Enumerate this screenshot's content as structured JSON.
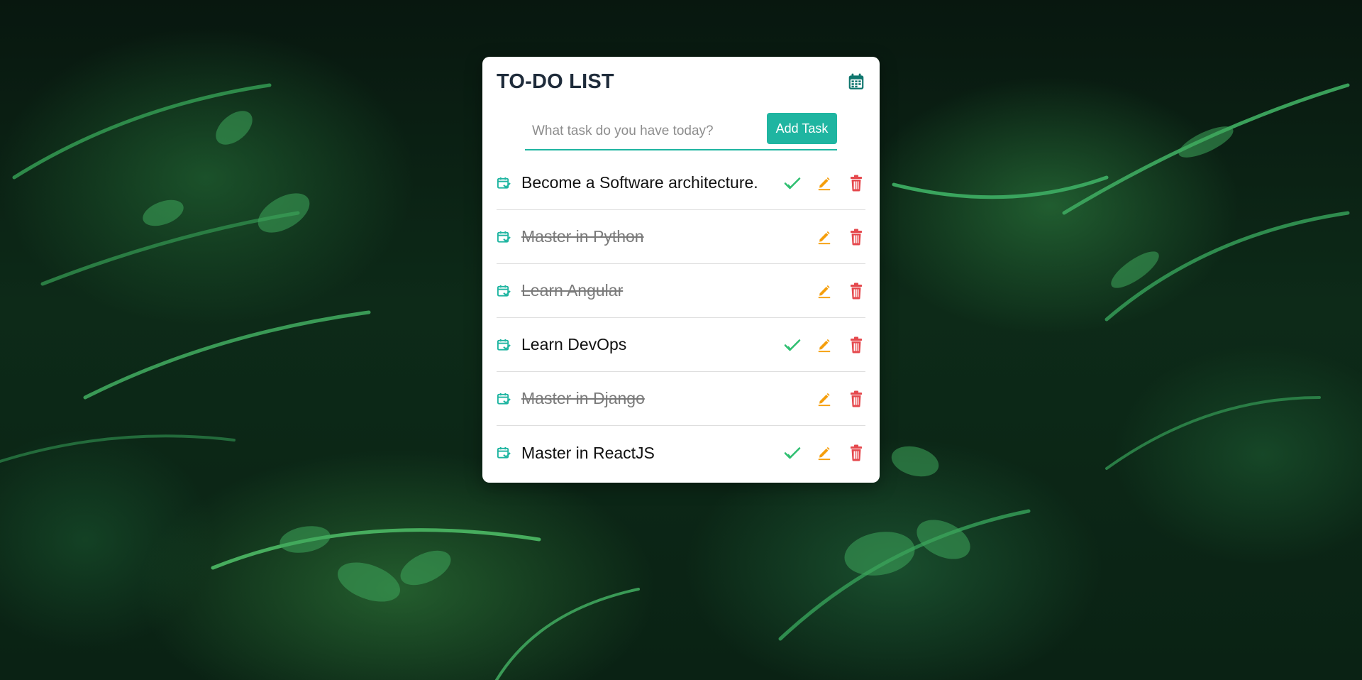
{
  "header": {
    "title": "TO-DO LIST",
    "calendar_icon": "calendar-icon"
  },
  "form": {
    "input_value": "",
    "input_placeholder": "What task do you have today?",
    "add_label": "Add Task"
  },
  "tasks": [
    {
      "text": "Become a Software architecture.",
      "completed": false
    },
    {
      "text": "Master in Python",
      "completed": true
    },
    {
      "text": "Learn Angular",
      "completed": true
    },
    {
      "text": "Learn DevOps",
      "completed": false
    },
    {
      "text": "Master in Django",
      "completed": true
    },
    {
      "text": "Master in ReactJS",
      "completed": false
    }
  ],
  "icons": {
    "task": "calendar-check-icon",
    "complete": "check-icon",
    "edit": "pencil-icon",
    "delete": "trash-icon"
  },
  "colors": {
    "accent": "#1fb5a1",
    "title": "#1e2b3a",
    "calendar_icon": "#0f766e",
    "complete": "#2fbf71",
    "edit": "#f59e0b",
    "delete": "#e5484d",
    "completed_text": "#7a7a7a"
  }
}
